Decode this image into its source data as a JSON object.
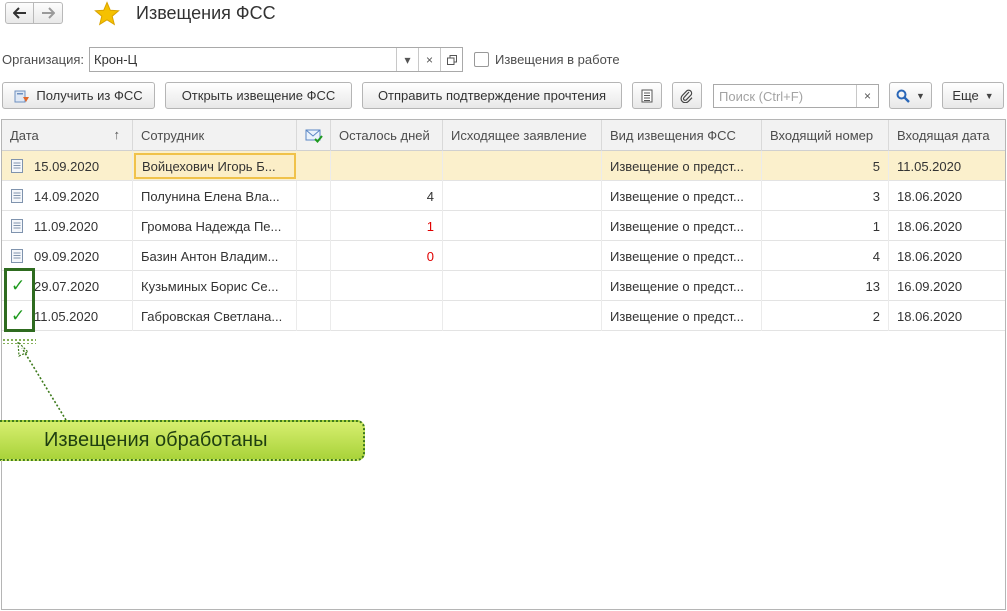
{
  "window": {
    "title": "Извещения ФСС"
  },
  "filter": {
    "org_label": "Организация:",
    "org_value": "Крон-Ц",
    "in_work_label": "Извещения в работе",
    "in_work_checked": false
  },
  "toolbar": {
    "get_label": "Получить из ФСС",
    "open_label": "Открыть извещение ФСС",
    "send_label": "Отправить подтверждение прочтения",
    "search_placeholder": "Поиск (Ctrl+F)",
    "more_label": "Еще"
  },
  "columns": {
    "date": "Дата",
    "employee": "Сотрудник",
    "days_left": "Осталось дней",
    "outgoing": "Исходящее заявление",
    "kind": "Вид извещения ФСС",
    "incoming_num": "Входящий номер",
    "incoming_date": "Входящая дата"
  },
  "rows": [
    {
      "status": "document",
      "date": "15.09.2020",
      "employee": "Войцехович Игорь Б...",
      "mail": false,
      "days_left": "",
      "outgoing": "",
      "kind": "Извещение о предст...",
      "incoming_num": "5",
      "incoming_date": "11.05.2020"
    },
    {
      "status": "document",
      "date": "14.09.2020",
      "employee": "Полунина Елена Вла...",
      "mail": true,
      "days_left": "4",
      "outgoing": "",
      "kind": "Извещение о предст...",
      "incoming_num": "3",
      "incoming_date": "18.06.2020"
    },
    {
      "status": "document",
      "date": "11.09.2020",
      "employee": "Громова Надежда Пе...",
      "mail": true,
      "days_left": "1",
      "outgoing": "",
      "kind": "Извещение о предст...",
      "incoming_num": "1",
      "incoming_date": "18.06.2020"
    },
    {
      "status": "document",
      "date": "09.09.2020",
      "employee": "Базин Антон Владим...",
      "mail": true,
      "days_left": "0",
      "outgoing": "",
      "kind": "Извещение о предст...",
      "incoming_num": "4",
      "incoming_date": "18.06.2020"
    },
    {
      "status": "processed",
      "date": "29.07.2020",
      "employee": "Кузьминых Борис Се...",
      "mail": false,
      "days_left": "",
      "outgoing": "",
      "kind": "Извещение о предст...",
      "incoming_num": "13",
      "incoming_date": "16.09.2020"
    },
    {
      "status": "processed",
      "date": "11.05.2020",
      "employee": "Габровская Светлана...",
      "mail": false,
      "days_left": "",
      "outgoing": "",
      "kind": "Извещение о предст...",
      "incoming_num": "2",
      "incoming_date": "18.06.2020"
    }
  ],
  "callout": {
    "text": "Извещения обработаны"
  },
  "colors": {
    "accent_star": "#f5c100",
    "selected_row": "#fbf0cc",
    "red_value": "#e00000",
    "check_green": "#1e9a1e",
    "callout_fill": "#bfe04f"
  }
}
